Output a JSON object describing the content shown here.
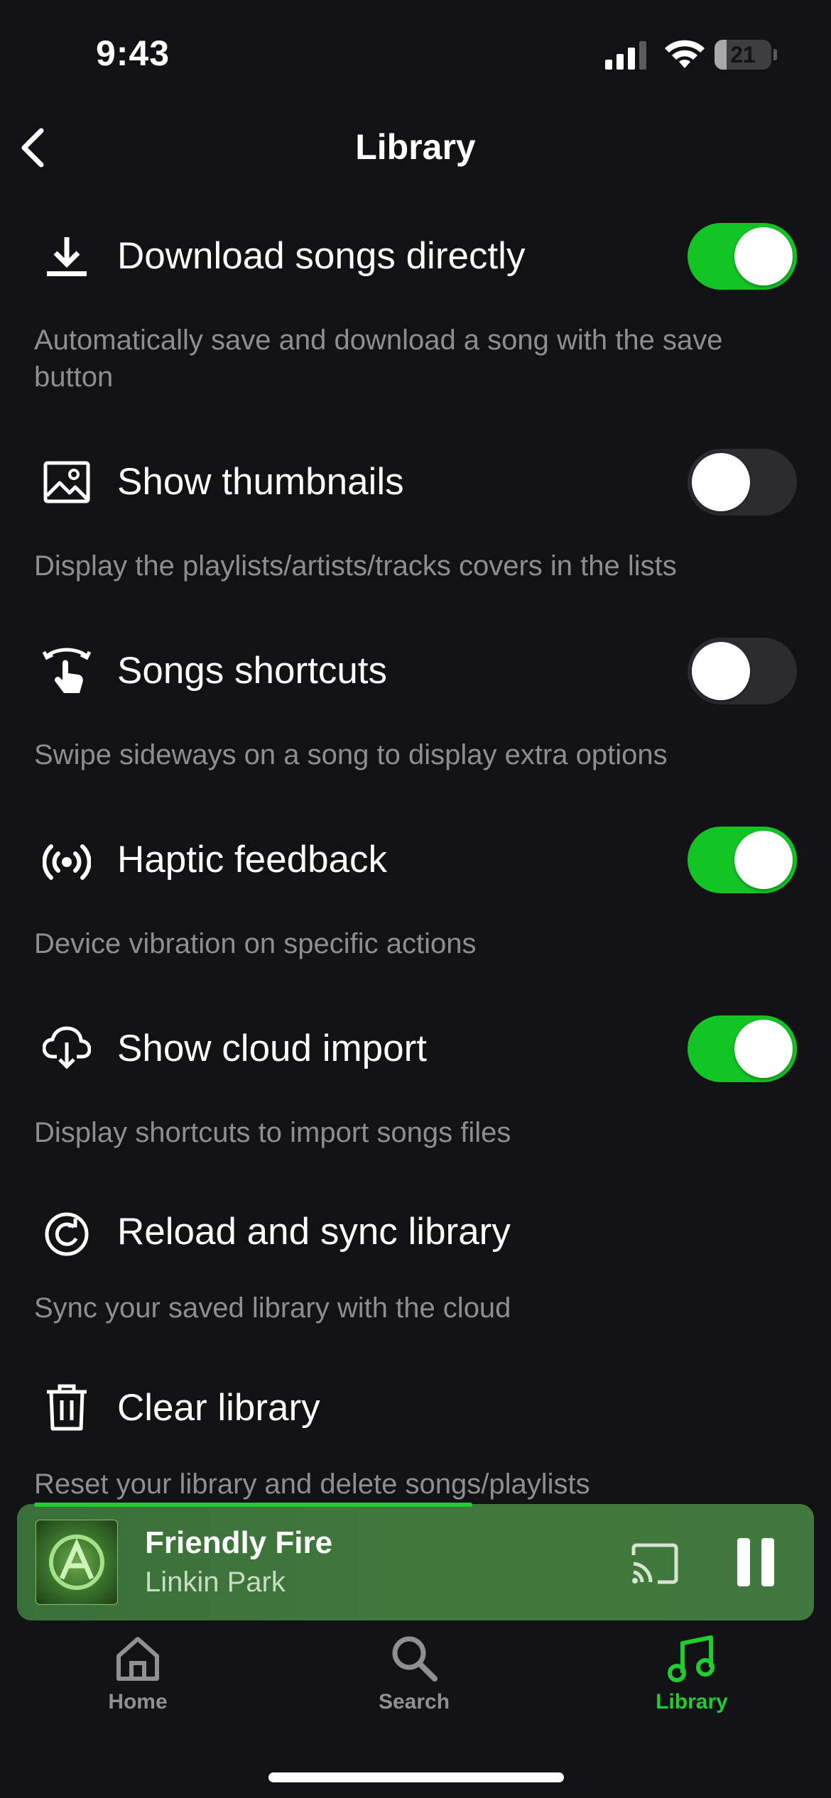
{
  "status_bar": {
    "time": "9:43",
    "battery": "21",
    "battery_level": 0.21
  },
  "header": {
    "title": "Library"
  },
  "settings": [
    {
      "label": "Download songs directly",
      "description": "Automatically save and download a song with the save button",
      "icon": "download-icon",
      "toggle": true
    },
    {
      "label": "Show thumbnails",
      "description": "Display the playlists/artists/tracks covers in the lists",
      "icon": "image-icon",
      "toggle": false
    },
    {
      "label": "Songs shortcuts",
      "description": "Swipe sideways on a song to display extra options",
      "icon": "swipe-gesture-icon",
      "toggle": false
    },
    {
      "label": "Haptic feedback",
      "description": "Device vibration on specific actions",
      "icon": "haptic-vibration-icon",
      "toggle": true
    },
    {
      "label": "Show cloud import",
      "description": "Display shortcuts to import songs files",
      "icon": "cloud-download-icon",
      "toggle": true
    },
    {
      "label": "Reload and sync library",
      "description": "Sync your saved library with the cloud",
      "icon": "reload-sync-icon"
    },
    {
      "label": "Clear library",
      "description": "Reset your library and delete songs/playlists",
      "icon": "trash-icon"
    }
  ],
  "player": {
    "track": "Friendly Fire",
    "artist": "Linkin Park",
    "progress": 0.55,
    "state": "playing"
  },
  "tabbar": {
    "items": [
      {
        "label": "Home",
        "icon": "home-icon",
        "active": false
      },
      {
        "label": "Search",
        "icon": "search-icon",
        "active": false
      },
      {
        "label": "Library",
        "icon": "music-note-icon",
        "active": true
      }
    ]
  },
  "colors": {
    "accent": "#13c425",
    "background": "#121215",
    "player_bg": "#40783c",
    "description_text": "#8d8d92"
  }
}
